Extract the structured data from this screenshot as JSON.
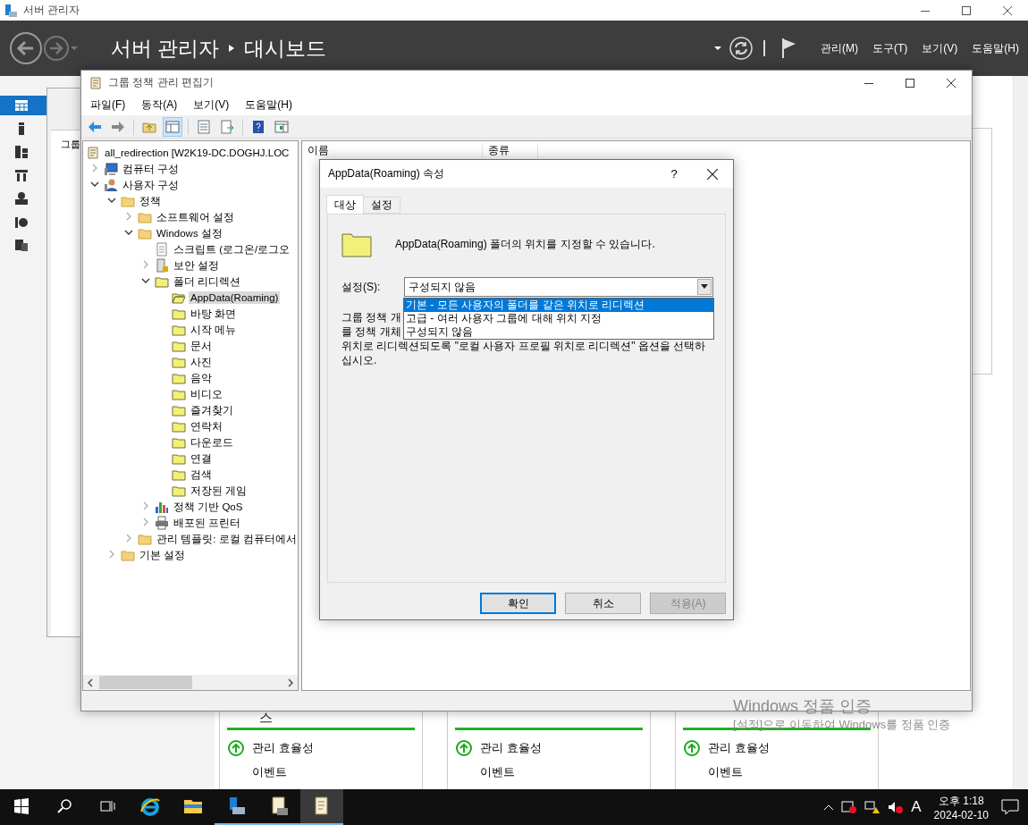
{
  "server_manager": {
    "title": "서버 관리자",
    "breadcrumb": [
      "서버 관리자",
      "대시보드"
    ],
    "menus": [
      "관리(M)",
      "도구(T)",
      "보기(V)",
      "도움말(H)"
    ],
    "sidebar": [
      {
        "kind": "dashboard",
        "selected": true
      },
      {
        "kind": "server",
        "selected": false
      },
      {
        "kind": "servers",
        "selected": false
      },
      {
        "kind": "adds",
        "selected": false
      },
      {
        "kind": "dns",
        "selected": false
      },
      {
        "kind": "iis",
        "selected": false
      },
      {
        "kind": "files",
        "selected": false
      }
    ],
    "cards": [
      {
        "title": "스",
        "items": [
          {
            "label": "관리 효율성",
            "kind": "status"
          },
          {
            "label": "이벤트",
            "kind": "plain"
          }
        ]
      },
      {
        "items": [
          {
            "label": "관리 효율성",
            "kind": "status"
          },
          {
            "label": "이벤트",
            "kind": "plain"
          }
        ]
      },
      {
        "items": [
          {
            "label": "관리 효율성",
            "kind": "status"
          },
          {
            "label": "이벤트",
            "kind": "plain"
          }
        ]
      }
    ]
  },
  "back_window": {
    "tree_item": "그룹"
  },
  "gpm": {
    "title": "그룹 정책 관리 편집기",
    "menus": [
      "파일(F)",
      "동작(A)",
      "보기(V)",
      "도움말(H)"
    ],
    "columns": [
      "이름",
      "종류"
    ],
    "tree": [
      {
        "label": "all_redirection [W2K19-DC.DOGHJ.LOC",
        "kind": "gpo",
        "selected": false,
        "children": [
          {
            "label": "컴퓨터 구성",
            "kind": "computer",
            "expanded": false,
            "selected": false
          },
          {
            "label": "사용자 구성",
            "kind": "user",
            "expanded": true,
            "selected": false,
            "children": [
              {
                "label": "정책",
                "kind": "folder",
                "expanded": true,
                "selected": false,
                "children": [
                  {
                    "label": "소프트웨어 설정",
                    "kind": "folder",
                    "expanded": false,
                    "selected": false
                  },
                  {
                    "label": "Windows 설정",
                    "kind": "folder",
                    "expanded": true,
                    "selected": false,
                    "children": [
                      {
                        "label": "스크립트 (로그온/로그오",
                        "kind": "script",
                        "selected": false
                      },
                      {
                        "label": "보안 설정",
                        "kind": "security",
                        "expanded": false,
                        "selected": false
                      },
                      {
                        "label": "폴더 리디렉션",
                        "kind": "redirect",
                        "expanded": true,
                        "selected": false,
                        "children": [
                          {
                            "label": "AppData(Roaming)",
                            "kind": "open_folder",
                            "selected": true
                          },
                          {
                            "label": "바탕 화면",
                            "kind": "redirect",
                            "selected": false
                          },
                          {
                            "label": "시작 메뉴",
                            "kind": "redirect",
                            "selected": false
                          },
                          {
                            "label": "문서",
                            "kind": "redirect",
                            "selected": false
                          },
                          {
                            "label": "사진",
                            "kind": "redirect",
                            "selected": false
                          },
                          {
                            "label": "음악",
                            "kind": "redirect",
                            "selected": false
                          },
                          {
                            "label": "비디오",
                            "kind": "redirect",
                            "selected": false
                          },
                          {
                            "label": "즐겨찾기",
                            "kind": "redirect",
                            "selected": false
                          },
                          {
                            "label": "연락처",
                            "kind": "redirect",
                            "selected": false
                          },
                          {
                            "label": "다운로드",
                            "kind": "redirect",
                            "selected": false
                          },
                          {
                            "label": "연결",
                            "kind": "redirect",
                            "selected": false
                          },
                          {
                            "label": "검색",
                            "kind": "redirect",
                            "selected": false
                          },
                          {
                            "label": "저장된 게임",
                            "kind": "redirect",
                            "selected": false
                          }
                        ]
                      },
                      {
                        "label": "정책 기반 QoS",
                        "kind": "chart",
                        "expanded": false,
                        "selected": false
                      },
                      {
                        "label": "배포된 프린터",
                        "kind": "printer",
                        "expanded": false,
                        "selected": false
                      }
                    ]
                  },
                  {
                    "label": "관리 템플릿: 로컬 컴퓨터에서",
                    "kind": "folder",
                    "expanded": false,
                    "selected": false
                  }
                ]
              },
              {
                "label": "기본 설정",
                "kind": "folder",
                "expanded": false,
                "selected": false
              }
            ]
          }
        ]
      }
    ]
  },
  "dialog": {
    "title": "AppData(Roaming) 속성",
    "help": "?",
    "tabs": [
      {
        "label": "대상",
        "selected": true
      },
      {
        "label": "설정",
        "selected": false
      }
    ],
    "intro": "AppData(Roaming) 폴더의 위치를 지정할 수 있습니다.",
    "setting_label": "설정(S):",
    "setting_value": "구성되지 않음",
    "options": [
      {
        "label": "기본 - 모든 사용자의 폴더를 같은 위치로 리디렉션",
        "selected": true
      },
      {
        "label": "고급 - 여러 사용자 그룹에 대해 위치 지정",
        "selected": false
      },
      {
        "label": "구성되지 않음",
        "selected": false
      }
    ],
    "description_lines": [
      "그룹 정책 개",
      "를 정책 개체",
      "위치로 리디렉션되도록 \"로컬 사용자 프로필 위치로 리디렉션\" 옵션을 선택하",
      "십시오."
    ],
    "buttons": [
      {
        "label": "확인",
        "kind": "default",
        "disabled": false
      },
      {
        "label": "취소",
        "kind": "normal",
        "disabled": false
      },
      {
        "label": "적용(A)",
        "kind": "normal",
        "disabled": true
      }
    ]
  },
  "activation": {
    "title": "Windows 정품 인증",
    "message": "[설정]으로 이동하여 Windows를 정품 인증"
  },
  "taskbar": {
    "apps": [
      {
        "kind": "start",
        "running": false,
        "selected": false
      },
      {
        "kind": "search",
        "running": false,
        "selected": false
      },
      {
        "kind": "taskview",
        "running": false,
        "selected": false
      },
      {
        "kind": "browser",
        "running": false,
        "selected": false
      },
      {
        "kind": "explorer",
        "running": false,
        "selected": false
      },
      {
        "kind": "servermanager",
        "running": true,
        "selected": false
      },
      {
        "kind": "gpm",
        "running": true,
        "selected": false
      },
      {
        "kind": "notepad",
        "running": true,
        "selected": true
      }
    ],
    "input_indicator": "A",
    "time": "오후 1:18",
    "date": "2024-02-10"
  }
}
